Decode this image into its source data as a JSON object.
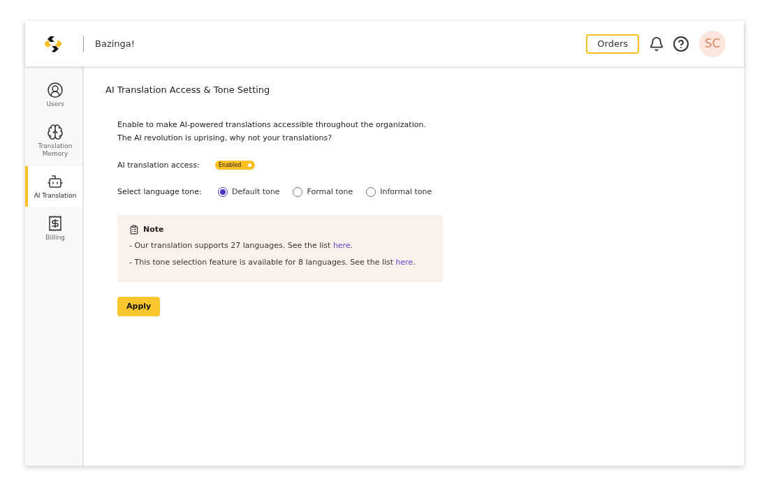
{
  "header": {
    "brand": "Bazinga!",
    "orders_button": "Orders",
    "avatar": "SC"
  },
  "sidebar": {
    "items": [
      {
        "label": "Users",
        "kind": "user",
        "selected": false
      },
      {
        "label": "Translation Memory",
        "kind": "brain",
        "selected": false
      },
      {
        "label": "AI Translation",
        "kind": "robot",
        "selected": true
      },
      {
        "label": "Billing",
        "kind": "receipt",
        "selected": false
      }
    ]
  },
  "page": {
    "title": "AI Translation Access & Tone Setting",
    "description": [
      "Enable to make AI-powered translations accessible throughout the organization.",
      "The AI revolution is uprising, why not your translations?"
    ],
    "access": {
      "label": "AI translation access:",
      "toggle_label": "Enabled",
      "on": true
    },
    "tone": {
      "label": "Select language tone:",
      "options": [
        {
          "label": "Default tone",
          "selected": true
        },
        {
          "label": "Formal tone",
          "selected": false
        },
        {
          "label": "Informal tone",
          "selected": false
        }
      ]
    },
    "note": {
      "title": "Note",
      "lines": [
        {
          "text": "- Our translation supports 27 languages. See the list ",
          "link": "here",
          "after": "."
        },
        {
          "text": "- This tone selection feature is available for 8 languages. See the list ",
          "link": "here",
          "after": "."
        }
      ]
    },
    "apply_button": "Apply"
  }
}
